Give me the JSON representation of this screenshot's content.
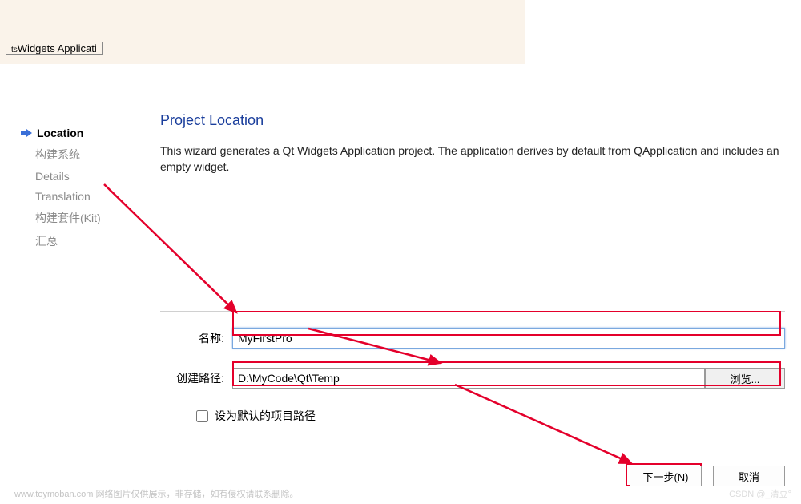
{
  "tab_title": "Widgets Applicati",
  "sidebar": {
    "items": [
      {
        "label": "Location",
        "active": true
      },
      {
        "label": "构建系统",
        "active": false
      },
      {
        "label": "Details",
        "active": false
      },
      {
        "label": "Translation",
        "active": false
      },
      {
        "label": "构建套件(Kit)",
        "active": false
      },
      {
        "label": "汇总",
        "active": false
      }
    ]
  },
  "main": {
    "heading": "Project Location",
    "description": "This wizard generates a Qt Widgets Application project. The application derives by default from QApplication and includes an empty widget.",
    "name_label": "名称:",
    "name_value": "MyFirstPro",
    "path_label": "创建路径:",
    "path_value": "D:\\MyCode\\Qt\\Temp",
    "browse_label": "浏览...",
    "checkbox_label": "设为默认的项目路径"
  },
  "buttons": {
    "next": "下一步(N)",
    "cancel": "取消"
  },
  "watermark_left": "www.toymoban.com 网络图片仅供展示，非存储，如有侵权请联系删除。",
  "watermark_right": "CSDN @_清豆°"
}
